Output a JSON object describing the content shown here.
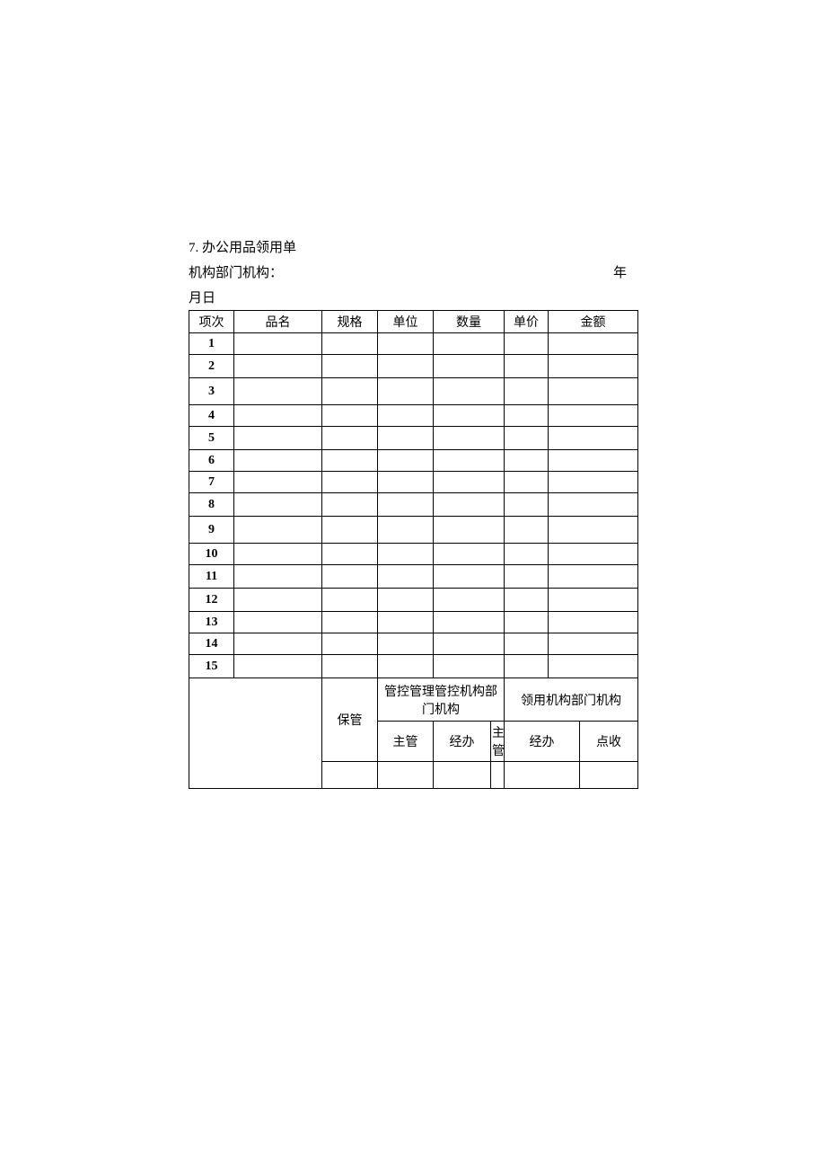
{
  "header": {
    "title": "7. 办公用品领用单",
    "org_label": "机构部门机构：",
    "year_label": "年",
    "month_day_label": "月日"
  },
  "columns": {
    "c1": "项次",
    "c2": "品名",
    "c3": "规格",
    "c4": "单位",
    "c5": "数量",
    "c6": "单价",
    "c7": "金额"
  },
  "rows": [
    {
      "num": "1"
    },
    {
      "num": "2"
    },
    {
      "num": "3"
    },
    {
      "num": "4"
    },
    {
      "num": "5"
    },
    {
      "num": "6"
    },
    {
      "num": "7"
    },
    {
      "num": "8"
    },
    {
      "num": "9"
    },
    {
      "num": "10"
    },
    {
      "num": "11"
    },
    {
      "num": "12"
    },
    {
      "num": "13"
    },
    {
      "num": "14"
    },
    {
      "num": "15"
    }
  ],
  "footer": {
    "baoguan": "保管",
    "guankong_dept": "管控管理管控机构部门机构",
    "lingyong_dept": "领用机构部门机构",
    "zhuguan": "主管",
    "jingban": "经办",
    "dianshou": "点收"
  }
}
